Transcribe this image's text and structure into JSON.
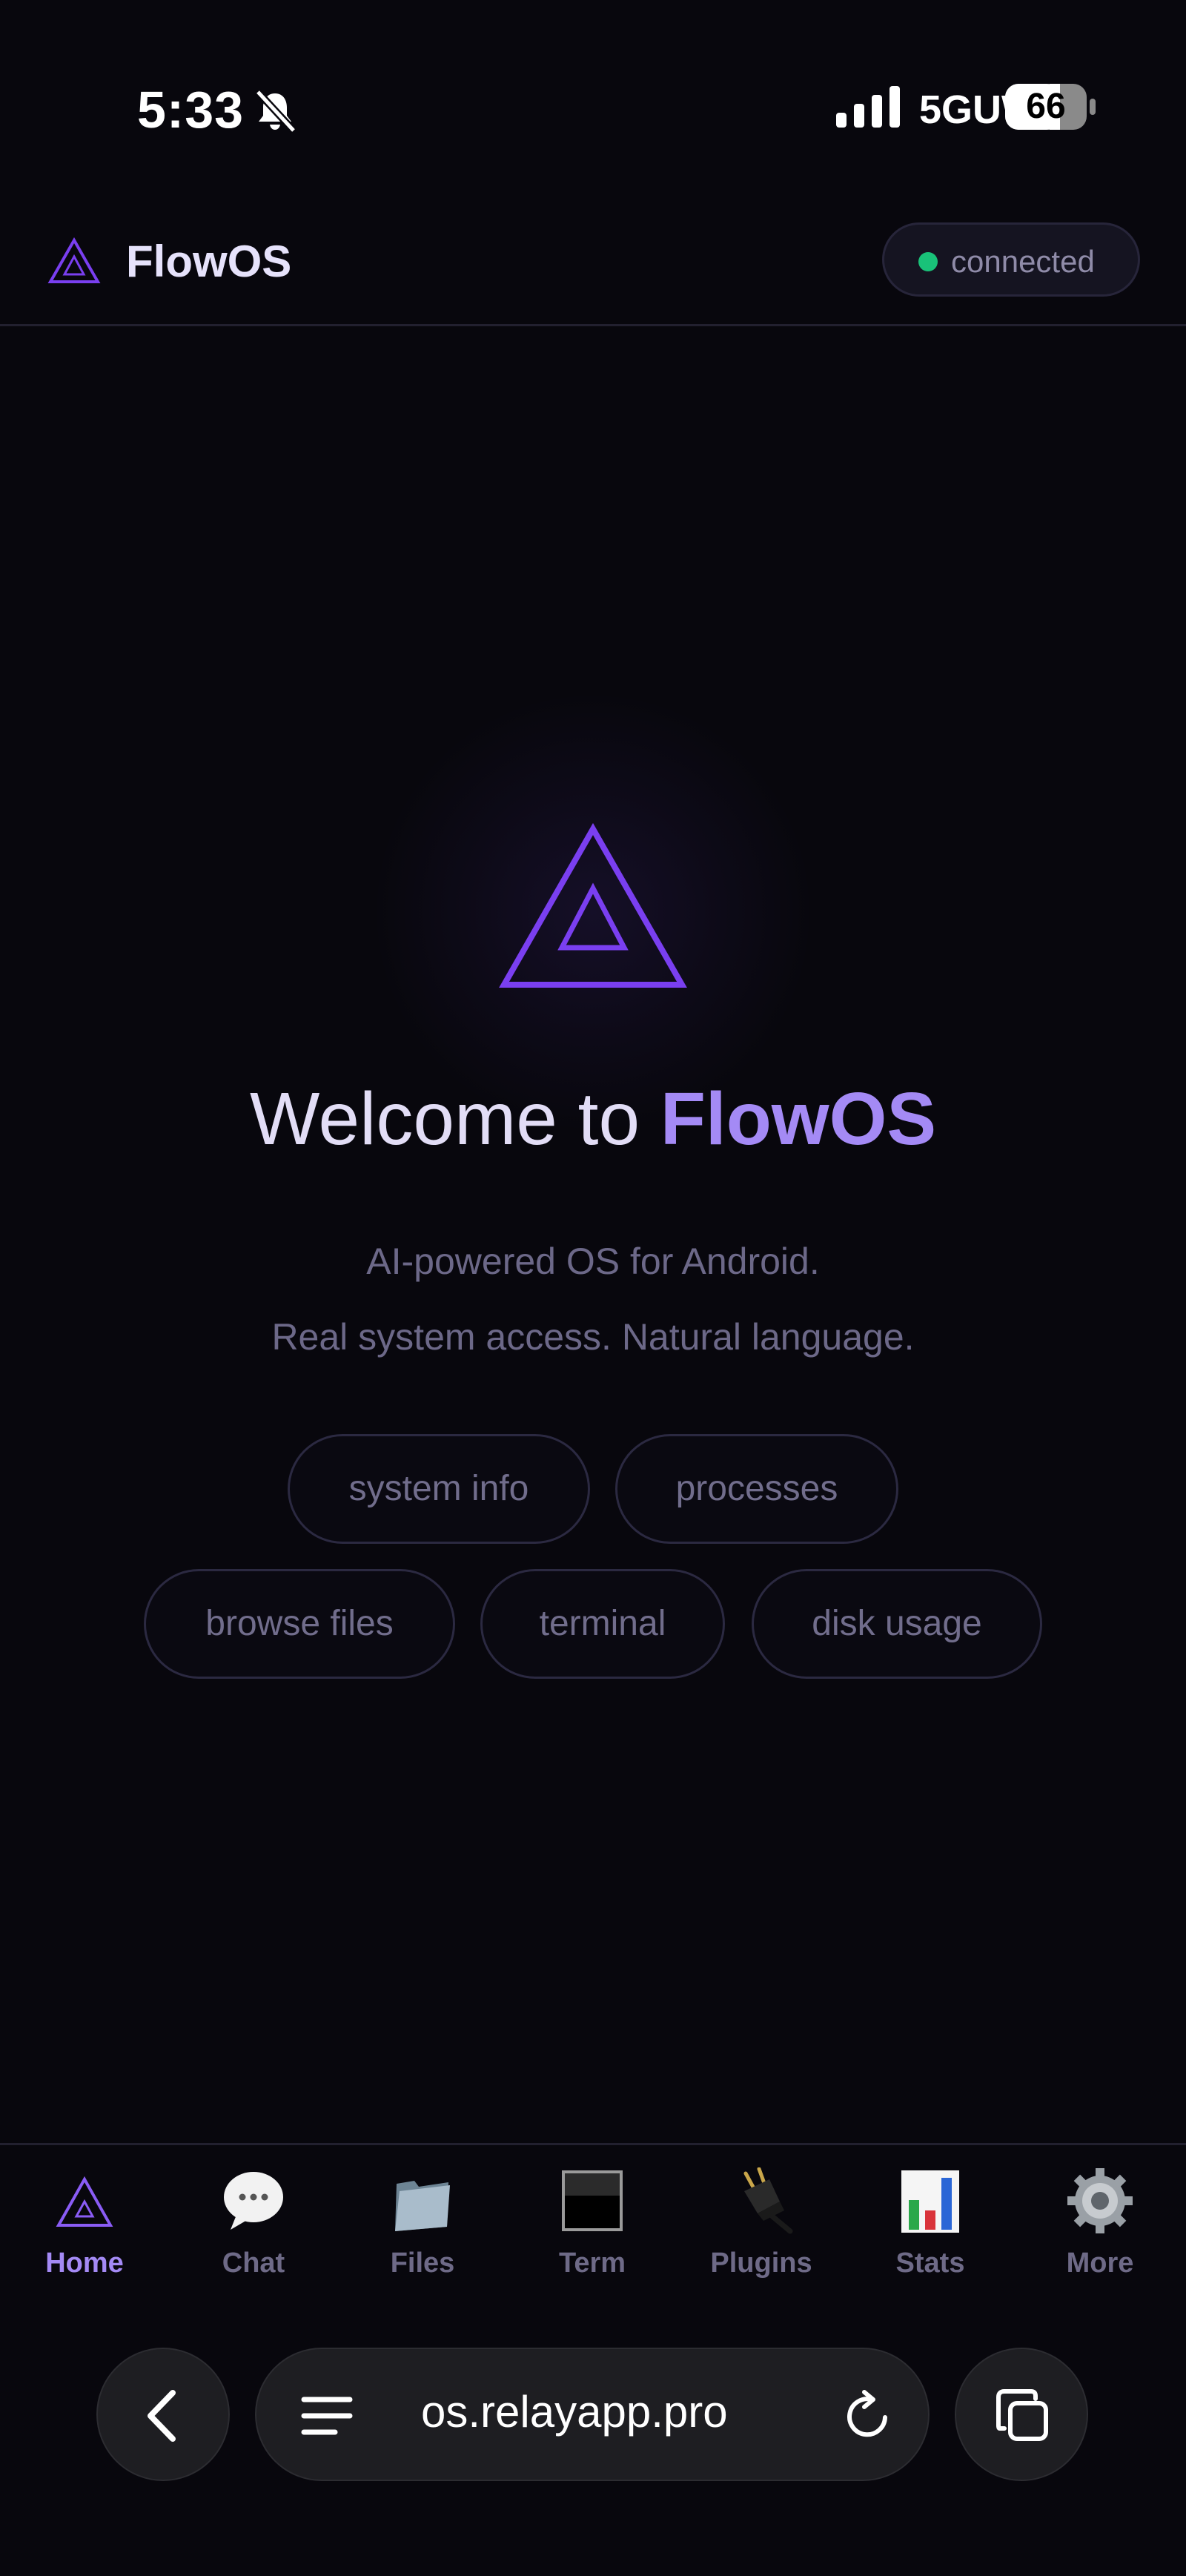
{
  "status_bar": {
    "time": "5:33",
    "network": "5GUW",
    "battery": "66"
  },
  "header": {
    "app_name": "FlowOS",
    "connection_status": "connected"
  },
  "hero": {
    "welcome_prefix": "Welcome to ",
    "welcome_brand": "FlowOS",
    "tagline_line1": "AI-powered OS for Android.",
    "tagline_line2": "Real system access. Natural language."
  },
  "chips": {
    "system_info": "system info",
    "processes": "processes",
    "browse_files": "browse files",
    "terminal": "terminal",
    "disk_usage": "disk usage"
  },
  "bottom_nav": {
    "items": [
      {
        "label": "Home",
        "icon": "triangle-logo-icon",
        "active": true
      },
      {
        "label": "Chat",
        "icon": "speech-bubble-icon",
        "active": false
      },
      {
        "label": "Files",
        "icon": "folder-icon",
        "active": false
      },
      {
        "label": "Term",
        "icon": "terminal-icon",
        "active": false
      },
      {
        "label": "Plugins",
        "icon": "plug-icon",
        "active": false
      },
      {
        "label": "Stats",
        "icon": "bar-chart-icon",
        "active": false
      },
      {
        "label": "More",
        "icon": "gear-icon",
        "active": false
      }
    ]
  },
  "browser": {
    "url": "os.relayapp.pro"
  },
  "colors": {
    "background": "#08070d",
    "accent": "#a48af5",
    "logo_stroke": "#7a3ff0",
    "status_online": "#19c279",
    "muted_text": "#6c6888"
  }
}
